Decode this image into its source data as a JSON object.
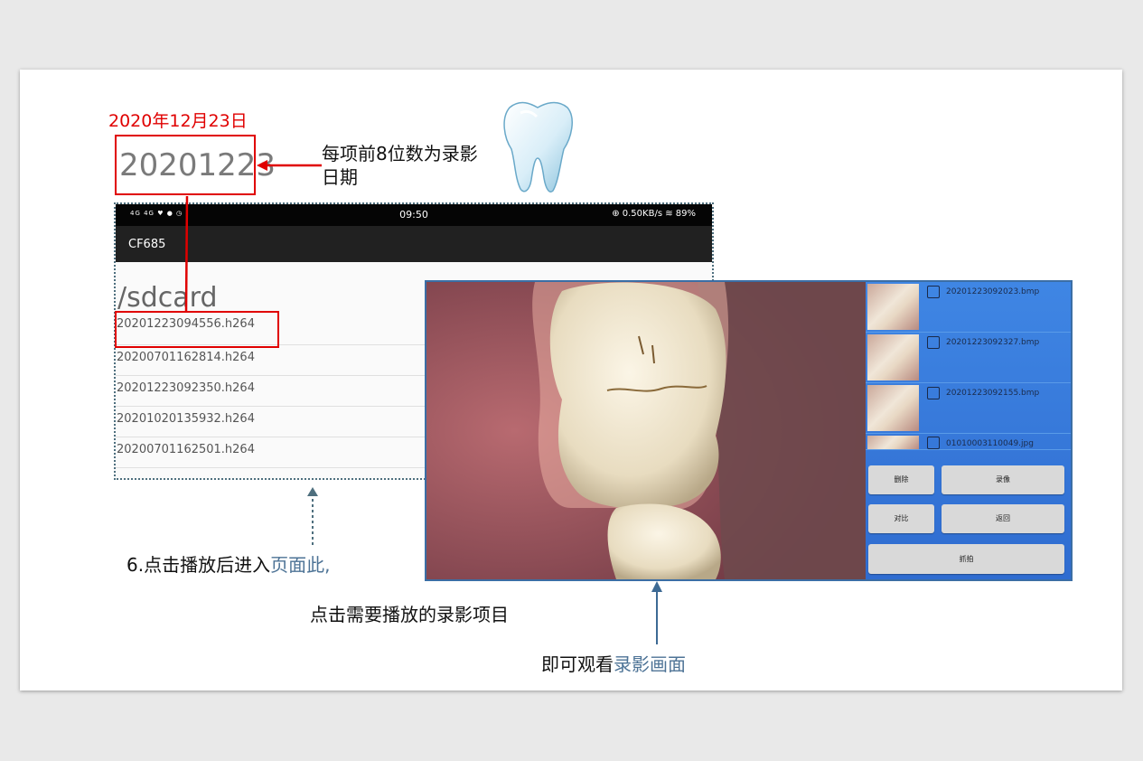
{
  "annotations": {
    "date_red": "2020年12月23日",
    "big_date": "20201223",
    "note": "每项前8位数为录影日期",
    "step6_prefix": "6.点击播放后进入",
    "step6_blue": "页面此,",
    "tap_text": "点击需要播放的录影项目",
    "watch_prefix": "即可观看",
    "watch_blue": "录影画面"
  },
  "phone": {
    "status_left": "4G 4G ♥ ● ◷",
    "time": "09:50",
    "status_right": "⊕ 0.50KB/s ≋ 89%",
    "app_title": "CF685",
    "path": "/sdcard",
    "files": [
      "20201223094556.h264",
      "20200701162814.h264",
      "20201223092350.h264",
      "20201020135932.h264",
      "20200701162501.h264"
    ]
  },
  "viewer": {
    "thumbnails": [
      "20201223092023.bmp",
      "20201223092327.bmp",
      "20201223092155.bmp",
      "01010003110049.jpg"
    ],
    "buttons": {
      "delete": "删除",
      "record": "录像",
      "compare": "对比",
      "back": "返回",
      "capture": "抓拍"
    }
  },
  "colors": {
    "annotation_red": "#e00000",
    "accent_blue": "#4d7396",
    "viewer_panel": "#3a6fc6"
  }
}
